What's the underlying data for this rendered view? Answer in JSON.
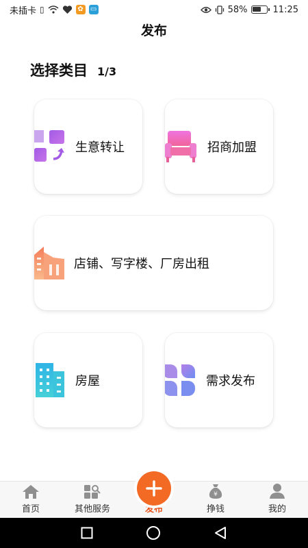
{
  "status_bar": {
    "carrier": "未插卡",
    "battery": "58%",
    "time": "11:25"
  },
  "header": {
    "title": "发布"
  },
  "section": {
    "title": "选择类目",
    "step": "1/3"
  },
  "categories": [
    {
      "label": "生意转让",
      "icon": "transfer-icon",
      "color": "#b05fe0"
    },
    {
      "label": "招商加盟",
      "icon": "sofa-icon",
      "color": "#e86bd6"
    },
    {
      "label": "店铺、写字楼、厂房出租",
      "icon": "building-icon",
      "color": "#f5906a"
    },
    {
      "label": "房屋",
      "icon": "tower-icon",
      "color": "#36bde0"
    },
    {
      "label": "需求发布",
      "icon": "clover-icon",
      "color": "#8f86e8"
    }
  ],
  "bottom_nav": {
    "items": [
      {
        "label": "首页",
        "icon": "home-icon"
      },
      {
        "label": "其他服务",
        "icon": "grid-search-icon"
      },
      {
        "label": "发布",
        "icon": "plus-icon",
        "active": true
      },
      {
        "label": "挣钱",
        "icon": "money-bag-icon"
      },
      {
        "label": "我的",
        "icon": "user-icon"
      }
    ]
  },
  "colors": {
    "accent": "#f26a24"
  }
}
